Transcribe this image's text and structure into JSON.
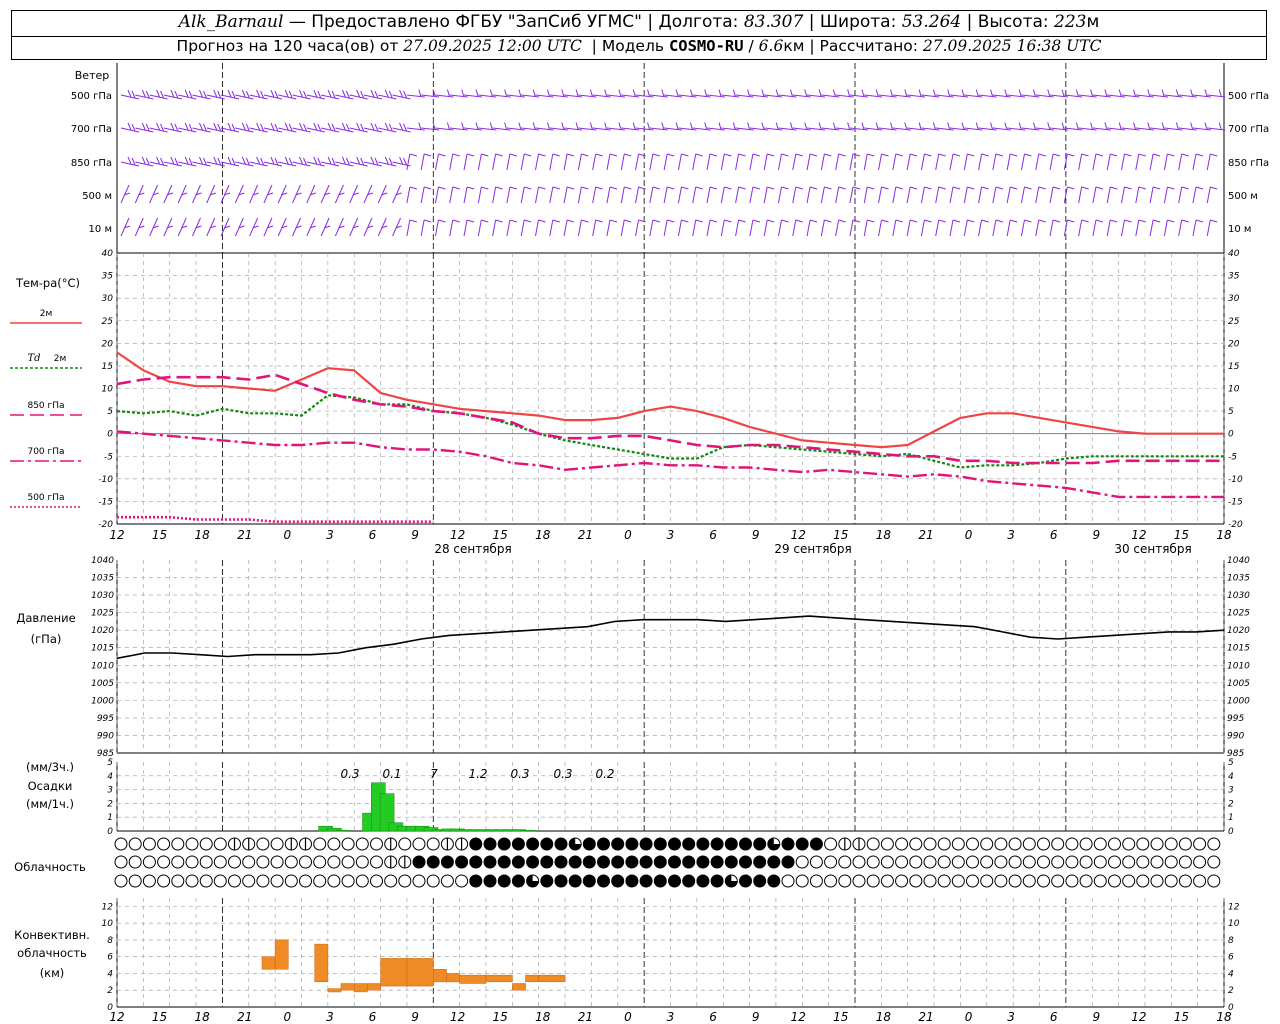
{
  "header": {
    "station": "Alk_Barnaul",
    "provider": "Предоставлено ФГБУ \"ЗапСиб УГМС\"",
    "lon_label": "Долгота:",
    "lon": "83.307",
    "lat_label": "Широта:",
    "lat": "53.264",
    "alt_label": "Высота:",
    "alt": "223",
    "alt_unit": "м",
    "forecast_prefix": "Прогноз на 120 часа(ов) от",
    "forecast_start": "27.09.2025 12:00 UTC",
    "model_label": "Модель",
    "model": "COSMO-RU",
    "resolution": "6.6",
    "res_unit": "км",
    "calc_label": "Рассчитано:",
    "calc_time": "27.09.2025 16:38 UTC"
  },
  "colors": {
    "wind": "#8a2be2",
    "t2m": "#ee4444",
    "td2m": "#118811",
    "t850": "#e0147a",
    "t700": "#e0147a",
    "t500": "#e0147a",
    "pressure": "#000000",
    "precip": "#22cc22",
    "convective": "#f08a24",
    "grid": "#999999"
  },
  "wind": {
    "title": "Ветер",
    "levels": [
      "500 гПа",
      "700 гПа",
      "850 гПа",
      "500 м",
      "10 м"
    ]
  },
  "temp": {
    "title": "Тем-ра(°С)",
    "legend": [
      {
        "key": "t2m",
        "label": "2м"
      },
      {
        "key": "td2m",
        "label_td": "Td",
        "label": "2м"
      },
      {
        "key": "t850",
        "label": "850 гПа"
      },
      {
        "key": "t700",
        "label": "700 гПа"
      },
      {
        "key": "t500",
        "label": "500 гПа"
      }
    ]
  },
  "time_axis": {
    "hour_labels": [
      "12",
      "15",
      "18",
      "21",
      "0",
      "3",
      "6",
      "9",
      "12",
      "15",
      "18",
      "21",
      "0",
      "3",
      "6",
      "9",
      "12",
      "15",
      "18",
      "21",
      "0",
      "3",
      "6",
      "9",
      "12",
      "15",
      "18"
    ],
    "day_labels": [
      "28 сентября",
      "29 сентября",
      "30 сентября"
    ]
  },
  "pressure": {
    "title": "Давление",
    "unit": "(гПа)"
  },
  "precip": {
    "unit3h": "(мм/3ч.)",
    "title": "Осадки",
    "unit1h": "(мм/1ч.)",
    "labels": [
      "0.3",
      "0.1",
      "7",
      "1.2",
      "0.3",
      "0.3",
      "0.2"
    ]
  },
  "clouds": {
    "title": "Облачность"
  },
  "convective": {
    "title1": "Конвективн.",
    "title2": "облачность",
    "unit": "(км)"
  },
  "chart_data": [
    {
      "type": "line",
      "name": "temperature",
      "x_hours": [
        0,
        3,
        6,
        9,
        12,
        15,
        18,
        21,
        24,
        27,
        30,
        33,
        36,
        39,
        42,
        45,
        48,
        51,
        54,
        57,
        60,
        63,
        66,
        69,
        72,
        75,
        78,
        81,
        84,
        87,
        90,
        93,
        96,
        99,
        102,
        105,
        108,
        111,
        114,
        117,
        120,
        123,
        126
      ],
      "series": [
        {
          "key": "t2m",
          "values": [
            18,
            14,
            11.5,
            10.5,
            10.5,
            10,
            9.5,
            12,
            14.5,
            14,
            9,
            7.5,
            6.5,
            5.5,
            5,
            4.5,
            4,
            3,
            3,
            3.5,
            5,
            6,
            5,
            3.5,
            1.5,
            0,
            -1.5,
            -2,
            -2.5,
            -3,
            -2.5,
            0.5,
            3.5,
            4.5,
            4.5,
            3.5,
            2.5,
            1.5,
            0.5,
            0,
            0,
            0,
            0
          ]
        },
        {
          "key": "td2m",
          "values": [
            5,
            4.5,
            5,
            4,
            5.5,
            4.5,
            4.5,
            4,
            8.5,
            8,
            6.5,
            6.5,
            5,
            4.5,
            3.5,
            2,
            0,
            -1.5,
            -2.5,
            -3.5,
            -4.5,
            -5.5,
            -5.5,
            -3,
            -2.5,
            -3,
            -3.5,
            -4,
            -4.5,
            -5,
            -4.5,
            -6,
            -7.5,
            -7,
            -7,
            -6.5,
            -5.5,
            -5,
            -5,
            -5,
            -5,
            -5,
            -5
          ]
        },
        {
          "key": "t850",
          "values": [
            11,
            12,
            12.5,
            12.5,
            12.5,
            12,
            13,
            11,
            9,
            7.5,
            6.5,
            6,
            5,
            4.5,
            3.5,
            2.5,
            0,
            -1,
            -1,
            -0.5,
            -0.5,
            -1.5,
            -2.5,
            -3,
            -2.5,
            -2.5,
            -3,
            -3.5,
            -4,
            -4.5,
            -5,
            -5,
            -6,
            -6,
            -6.5,
            -6.5,
            -6.5,
            -6.5,
            -6,
            -6,
            -6,
            -6,
            -6
          ]
        },
        {
          "key": "t700",
          "values": [
            0.5,
            0,
            -0.5,
            -1,
            -1.5,
            -2,
            -2.5,
            -2.5,
            -2,
            -2,
            -3,
            -3.5,
            -3.5,
            -4,
            -5,
            -6.5,
            -7,
            -8,
            -7.5,
            -7,
            -6.5,
            -7,
            -7,
            -7.5,
            -7.5,
            -8,
            -8.5,
            -8,
            -8.5,
            -9,
            -9.5,
            -9,
            -9.5,
            -10.5,
            -11,
            -11.5,
            -12,
            -13,
            -14,
            -14,
            -14,
            -14,
            -14
          ]
        },
        {
          "key": "t500",
          "values": [
            -18.5,
            -18.5,
            -18.5,
            -19,
            -19,
            -19,
            -19.5,
            -19.5,
            -19.5,
            -19.5,
            -19.5,
            -19.5,
            -19.5
          ]
        }
      ],
      "title": "Тем-ра(°С)",
      "ylim": [
        -20,
        40
      ],
      "yticks": [
        -20,
        -15,
        -10,
        -5,
        0,
        5,
        10,
        15,
        20,
        25,
        30,
        35,
        40
      ]
    },
    {
      "type": "line",
      "name": "pressure",
      "x_hours": [
        0,
        3,
        6,
        9,
        12,
        15,
        18,
        21,
        24,
        27,
        30,
        33,
        36,
        39,
        42,
        45,
        48,
        51,
        54,
        57,
        60,
        63,
        66,
        69,
        72,
        75,
        78,
        81,
        84,
        87,
        90,
        93,
        96,
        99,
        102,
        105,
        108,
        111,
        114,
        117,
        120
      ],
      "values": [
        1012,
        1013.5,
        1013.5,
        1013,
        1012.5,
        1013,
        1013,
        1013,
        1013.5,
        1015,
        1016,
        1017.5,
        1018.5,
        1019,
        1019.5,
        1020,
        1020.5,
        1021,
        1022.5,
        1023,
        1023,
        1023,
        1022.5,
        1023,
        1023.5,
        1024,
        1023.5,
        1023,
        1022.5,
        1022,
        1021.5,
        1021,
        1019.5,
        1018,
        1017.5,
        1018,
        1018.5,
        1019,
        1019.5,
        1019.5,
        1020
      ],
      "title": "Давление",
      "ylim": [
        985,
        1040
      ],
      "yticks": [
        985,
        990,
        995,
        1000,
        1005,
        1010,
        1015,
        1020,
        1025,
        1030,
        1035,
        1040
      ]
    },
    {
      "type": "bar",
      "name": "precipitation",
      "x_hours": [
        18,
        19,
        20,
        21,
        22,
        23,
        24,
        25,
        26,
        27,
        28,
        29,
        30,
        31,
        32,
        33,
        34,
        35,
        36,
        37,
        38,
        39,
        40,
        41,
        42,
        43,
        44,
        45,
        46,
        47,
        48,
        49,
        50,
        51,
        52,
        53,
        54
      ],
      "values": [
        0,
        0,
        0,
        0,
        0,
        0.35,
        0.2,
        0.05,
        0,
        0,
        1.3,
        3.5,
        2.7,
        0.6,
        0.35,
        0.35,
        0.35,
        0.25,
        0.1,
        0.15,
        0.15,
        0.1,
        0.1,
        0.1,
        0.1,
        0.1,
        0.1,
        0.1,
        0.05,
        0,
        0,
        0,
        0,
        0,
        0,
        0,
        0
      ],
      "totals_3h": [
        0.3,
        0.1,
        7,
        1.2,
        0.3,
        0.3,
        0.2
      ],
      "ylim": [
        0,
        5
      ]
    },
    {
      "type": "table",
      "name": "cloudiness",
      "levels": [
        "high",
        "mid",
        "low"
      ],
      "steps": 79,
      "step_hours": 1.5,
      "scale": "0=clear,4=overcast",
      "rows": [
        "00000000110011000001000114444444344444444444443444011000000000000000000000000000",
        "00000000000000000001144444444444444444444444444400000000000000000000000000000000",
        "00000000000000000000000004444344444444444443444000000000000000000000000000000000"
      ]
    },
    {
      "type": "bar",
      "name": "convective_cloud",
      "ylim": [
        0,
        13
      ],
      "yticks": [
        0,
        2,
        4,
        6,
        8,
        10,
        12
      ],
      "segments": [
        {
          "x": [
            16.5,
            18
          ],
          "bottom": 4.5,
          "top": 6
        },
        {
          "x": [
            18,
            19.5
          ],
          "bottom": 4.5,
          "top": 8
        },
        {
          "x": [
            22.5,
            24
          ],
          "bottom": 3,
          "top": 7.5
        },
        {
          "x": [
            24,
            25.5
          ],
          "bottom": 1.8,
          "top": 2.2
        },
        {
          "x": [
            25.5,
            27
          ],
          "bottom": 2,
          "top": 2.8
        },
        {
          "x": [
            27,
            28.5
          ],
          "bottom": 1.8,
          "top": 2.8
        },
        {
          "x": [
            28.5,
            30
          ],
          "bottom": 2,
          "top": 2.8
        },
        {
          "x": [
            30,
            33
          ],
          "bottom": 2.5,
          "top": 5.8
        },
        {
          "x": [
            33,
            36
          ],
          "bottom": 2.5,
          "top": 5.8
        },
        {
          "x": [
            36,
            37.5
          ],
          "bottom": 3,
          "top": 4.5
        },
        {
          "x": [
            37.5,
            39
          ],
          "bottom": 3,
          "top": 4
        },
        {
          "x": [
            39,
            42
          ],
          "bottom": 2.8,
          "top": 3.8
        },
        {
          "x": [
            42,
            45
          ],
          "bottom": 3,
          "top": 3.8
        },
        {
          "x": [
            45,
            46.5
          ],
          "bottom": 2,
          "top": 2.8
        },
        {
          "x": [
            46.5,
            48
          ],
          "bottom": 3,
          "top": 3.8
        },
        {
          "x": [
            48,
            51
          ],
          "bottom": 3,
          "top": 3.8
        }
      ]
    }
  ]
}
